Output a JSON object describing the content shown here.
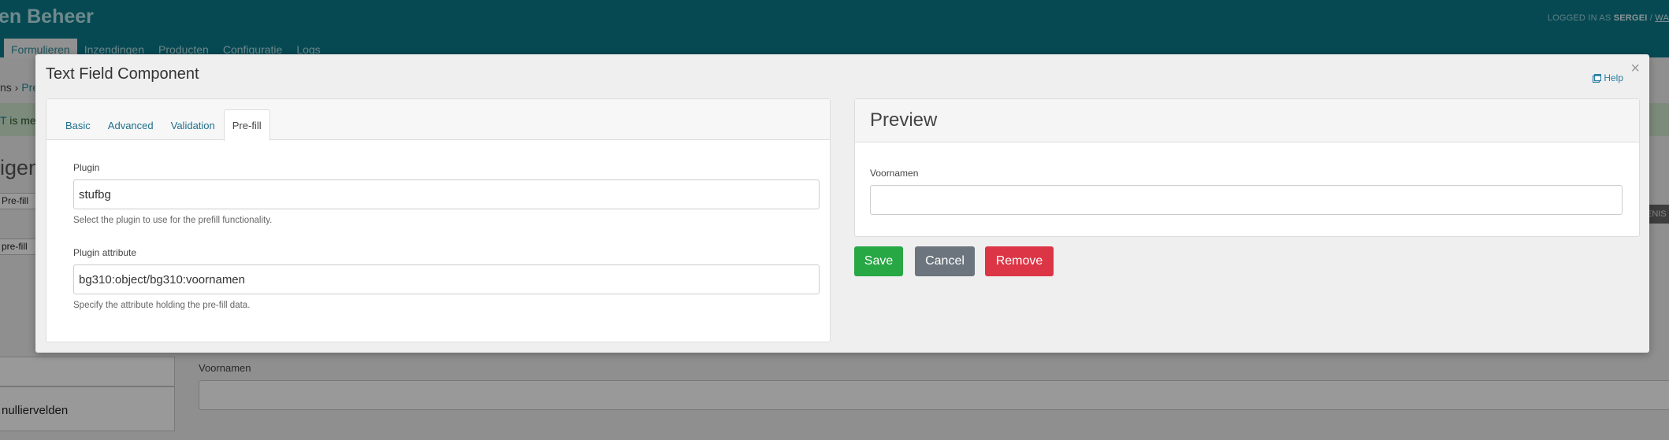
{
  "background": {
    "app_title": "en Beheer",
    "user": {
      "prefix": "LOGGED IN AS ",
      "name": "SERGEI",
      "sep": " / ",
      "link": "WA"
    },
    "nav": [
      "Formulieren",
      "Inzendingen",
      "Producten",
      "Configuratie",
      "Logs"
    ],
    "breadcrumb": {
      "start": "ns › ",
      "link": "Pre"
    },
    "alert": {
      "strong": "T",
      "text": " is met"
    },
    "heading": "igen",
    "side_top_label": "Pre-fill",
    "side_pre_label": "pre-fill",
    "right_button": "ENIS",
    "panel_label": "nulliervelden",
    "voornamen_label": "Voornamen"
  },
  "modal": {
    "title": "Text Field Component",
    "help_label": "Help",
    "close_label": "×"
  },
  "tabs": [
    "Basic",
    "Advanced",
    "Validation",
    "Pre-fill"
  ],
  "active_tab": "Pre-fill",
  "form": {
    "plugin": {
      "label": "Plugin",
      "value": "stufbg",
      "help": "Select the plugin to use for the prefill functionality."
    },
    "attribute": {
      "label": "Plugin attribute",
      "value": "bg310:object/bg310:voornamen",
      "help": "Specify the attribute holding the pre-fill data."
    }
  },
  "preview": {
    "title": "Preview",
    "field_label": "Voornamen",
    "field_value": ""
  },
  "buttons": {
    "save": "Save",
    "cancel": "Cancel",
    "remove": "Remove"
  },
  "colors": {
    "header": "#0a7b8a",
    "save": "#28a745",
    "cancel": "#6c757d",
    "remove": "#dc3545",
    "link": "#1f6f8b"
  }
}
